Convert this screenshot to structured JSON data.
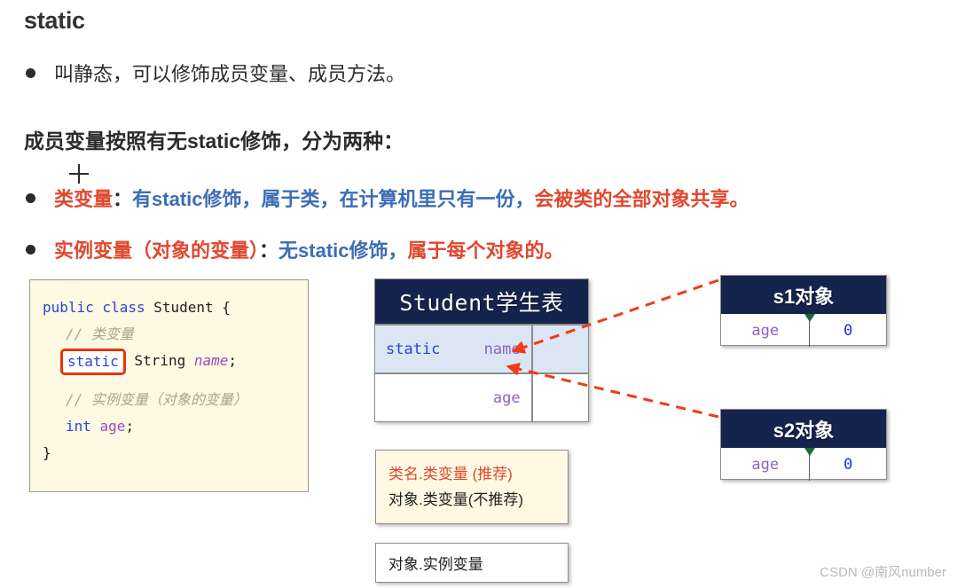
{
  "slide": {
    "title": "static",
    "heading2": "成员变量按照有无static修饰，分为两种："
  },
  "bullets": {
    "intro": "叫静态，可以修饰成员变量、成员方法。",
    "class_var": {
      "label": "类变量",
      "colon": "：",
      "blue_part": "有static修饰，属于类，在计算机里只有一份，",
      "red_part": "会被类的全部对象共享。"
    },
    "instance_var": {
      "label": "实例变量（对象的变量）",
      "colon": "：",
      "blue_part": "无static修饰，",
      "red_part": "属于每个对象的。"
    }
  },
  "code": {
    "line1_kw": "public class",
    "line1_cls": " Student {",
    "comment1": "// 类变量",
    "static_keyword": "static",
    "line3_rest": " String ",
    "line3_var": "name",
    "line3_semi": ";",
    "comment2": "// 实例变量（对象的变量）",
    "line5_kw": "int",
    "line5_var": " age",
    "line5_semi": ";",
    "line6": "}"
  },
  "student_table": {
    "header": "Student学生表",
    "rows": [
      {
        "modifier": "static",
        "field": "name",
        "value": ""
      },
      {
        "modifier": "",
        "field": "age",
        "value": ""
      }
    ]
  },
  "objects": [
    {
      "header": "s1对象",
      "field": "age",
      "value": "0"
    },
    {
      "header": "s2对象",
      "field": "age",
      "value": "0"
    }
  ],
  "notes": {
    "class_access": {
      "recommended": "类名.类变量 (推荐)",
      "not_recommended": "对象.类变量(不推荐)"
    },
    "instance_access": "对象.实例变量"
  },
  "watermark": "CSDN @南风number",
  "colors": {
    "red": "#e1472e",
    "blue": "#3d6db5",
    "navy": "#14244d",
    "code_bg": "#fdf9e3",
    "table_alt": "#dbe5f3",
    "arrow_red": "#f23a13",
    "highlight_border": "#e8330a"
  }
}
